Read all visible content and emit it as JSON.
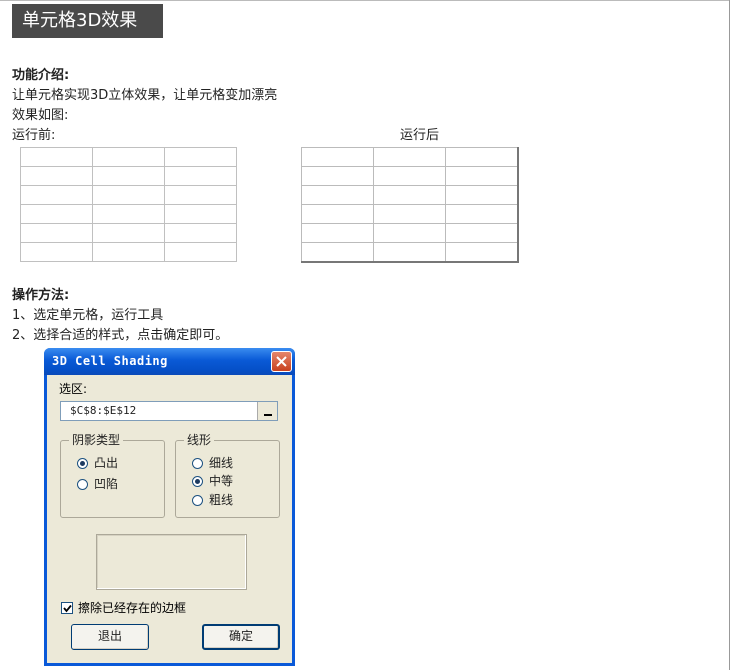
{
  "page": {
    "title": "单元格3D效果",
    "feature_heading": "功能介绍:",
    "feature_desc": "让单元格实现3D立体效果，让单元格变加漂亮",
    "effect_label": "效果如图:",
    "before_label": "运行前:",
    "after_label": "运行后",
    "method_heading": "操作方法:",
    "steps": [
      "1、选定单元格，运行工具",
      "2、选择合适的样式，点击确定即可。"
    ]
  },
  "grids": {
    "before_rows": 6,
    "after_rows": 6,
    "columns": 3
  },
  "dialog": {
    "title": "3D Cell Shading",
    "close_icon": "close-icon",
    "range_label": "选区:",
    "range_value": "$C$8:$E$12",
    "shadow_group": {
      "title": "阴影类型",
      "options": [
        "凸出",
        "凹陷"
      ],
      "selected": "凸出"
    },
    "line_group": {
      "title": "线形",
      "options": [
        "细线",
        "中等",
        "粗线"
      ],
      "selected": "中等"
    },
    "clear_borders_label": "擦除已经存在的边框",
    "clear_borders_checked": true,
    "exit_button": "退出",
    "ok_button": "确定"
  },
  "colors": {
    "titlebar": "#0a5ad6",
    "dialog_bg": "#ece9d8",
    "page_title_bg": "#4a4a4a"
  }
}
